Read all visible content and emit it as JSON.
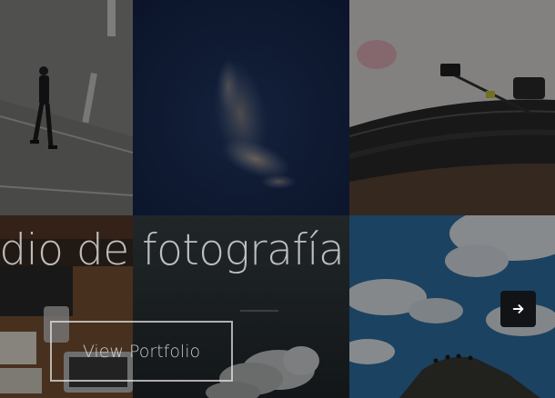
{
  "hero": {
    "headline": "udio de fotografía",
    "cta_label": "View Portfolio"
  },
  "slider": {
    "next_icon": "arrow-right-icon"
  },
  "gallery": {
    "tiles": [
      {
        "name": "street-photo",
        "subject": "person walking on road"
      },
      {
        "name": "night-sky-photo",
        "subject": "wispy cloud in dark blue sky"
      },
      {
        "name": "turntable-photo",
        "subject": "vinyl record player"
      },
      {
        "name": "desk-photo",
        "subject": "camera and devices on desk"
      },
      {
        "name": "clouds-photo",
        "subject": "clouds in dark sky"
      },
      {
        "name": "hilltop-photo",
        "subject": "people on rocky hill under cloudy sky"
      }
    ]
  },
  "colors": {
    "overlay": "rgba(0,0,0,0.42)",
    "button_bg": "#111316",
    "text": "#ebebeb"
  }
}
